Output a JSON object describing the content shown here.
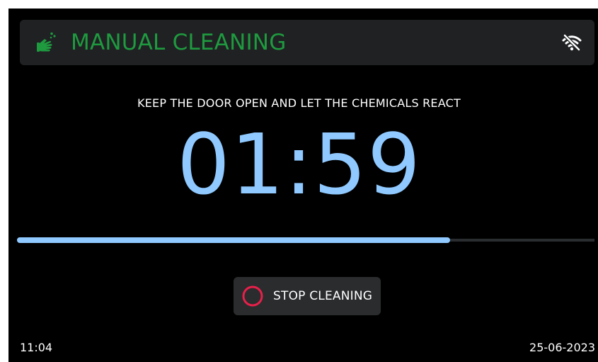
{
  "header": {
    "title": "MANUAL CLEANING",
    "title_color": "#1f9a3f",
    "icon": "cleaning-hand-icon",
    "status_icon": "wifi-off-icon"
  },
  "main": {
    "instruction": "KEEP THE DOOR OPEN AND LET THE CHEMICALS REACT",
    "timer": "01:59",
    "progress": 0.75,
    "progress_color": "#8fc9ff"
  },
  "actions": {
    "stop_label": "STOP CLEANING",
    "stop_icon": "stop-circle-icon",
    "stop_icon_color": "#e8204a"
  },
  "footer": {
    "time": "11:04",
    "date": "25-06-2023"
  }
}
